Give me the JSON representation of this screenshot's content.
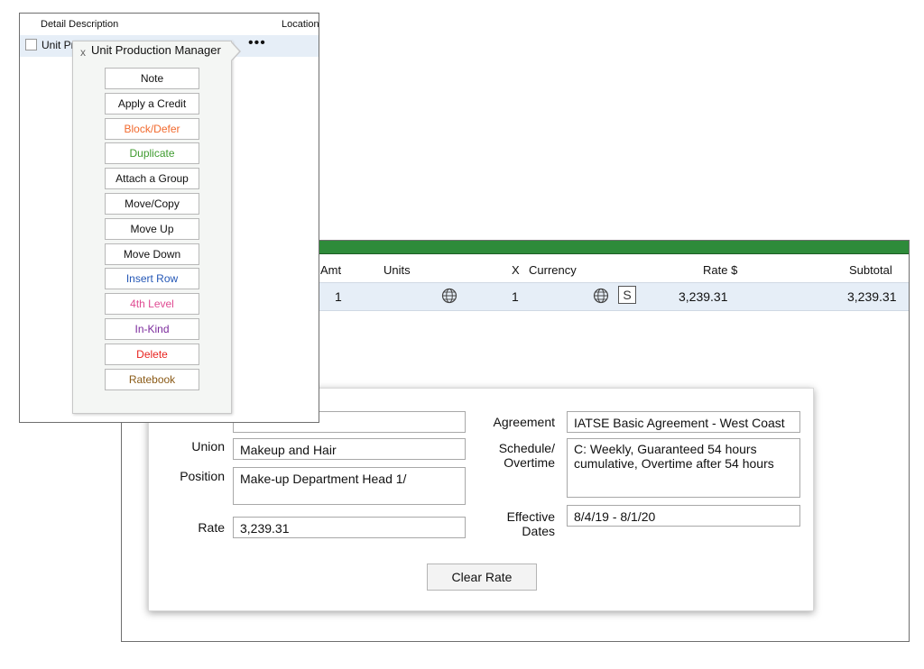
{
  "popup": {
    "header": {
      "detail_description": "Detail Description",
      "location": "Location"
    },
    "row_text": "Unit Pr",
    "more_icon": "•••",
    "menu": {
      "close": "x",
      "title": "Unit Production Manager",
      "items": [
        {
          "label": "Note",
          "color": "#111111"
        },
        {
          "label": "Apply a Credit",
          "color": "#111111"
        },
        {
          "label": "Block/Defer",
          "color": "#f26a2e"
        },
        {
          "label": "Duplicate",
          "color": "#3f9b2f"
        },
        {
          "label": "Attach a Group",
          "color": "#111111"
        },
        {
          "label": "Move/Copy",
          "color": "#111111"
        },
        {
          "label": "Move Up",
          "color": "#111111"
        },
        {
          "label": "Move Down",
          "color": "#111111"
        },
        {
          "label": "Insert Row",
          "color": "#2457b6"
        },
        {
          "label": "4th Level",
          "color": "#e04c93"
        },
        {
          "label": "In-Kind",
          "color": "#7b2a9c"
        },
        {
          "label": "Delete",
          "color": "#e8231f"
        },
        {
          "label": "Ratebook",
          "color": "#8a5a16"
        }
      ]
    }
  },
  "grid": {
    "header_color": "#2e8b3a",
    "columns": {
      "amt": "Amt",
      "units": "Units",
      "x": "X",
      "currency": "Currency",
      "rate": "Rate $",
      "subtotal": "Subtotal"
    },
    "row": {
      "amt": "1",
      "x": "1",
      "dollar_icon": "S",
      "rate": "3,239.31",
      "subtotal": "3,239.31"
    }
  },
  "rate_detail": {
    "union_label": "Union",
    "union_value": "Makeup and Hair",
    "position_label": "Position",
    "position_value": "Make-up Department Head 1/",
    "rate_label": "Rate",
    "rate_value": "3,239.31",
    "agreement_label": "Agreement",
    "agreement_value": "IATSE Basic Agreement - West Coast",
    "schedule_label_1": "Schedule/",
    "schedule_label_2": "Overtime",
    "schedule_value": "C: Weekly, Guaranteed 54 hours cumulative, Overtime after 54 hours",
    "effective_label_1": "Effective",
    "effective_label_2": "Dates",
    "effective_value": "8/4/19 - 8/1/20",
    "clear_rate_label": "Clear Rate"
  }
}
